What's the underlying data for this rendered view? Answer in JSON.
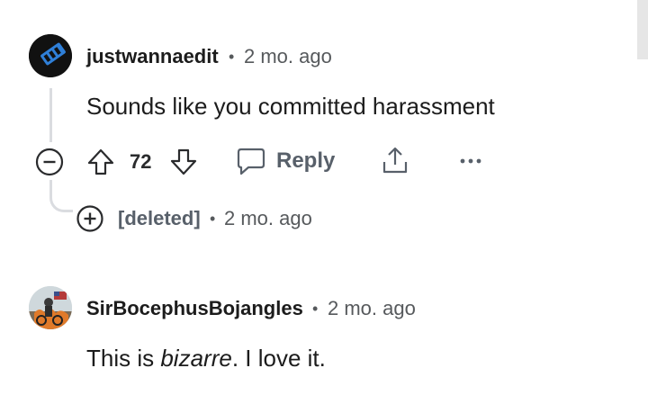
{
  "comments": [
    {
      "username": "justwannaedit",
      "separator": "•",
      "age": "2 mo. ago",
      "text": "Sounds like you committed harassment",
      "actions": {
        "upvotes": "72",
        "reply_label": "Reply"
      },
      "collapsed_child": {
        "username": "[deleted]",
        "separator": "•",
        "age": "2 mo. ago"
      }
    },
    {
      "username": "SirBocephusBojangles",
      "separator": "•",
      "age": "2 mo. ago",
      "text_before": "This is ",
      "text_italic": "bizarre",
      "text_after": ". I love it."
    }
  ],
  "icons": {
    "collapse": "minus-circle-icon",
    "upvote": "arrow-up-icon",
    "downvote": "arrow-down-icon",
    "reply": "speech-bubble-icon",
    "share": "share-icon",
    "more": "ellipsis-icon",
    "expand": "plus-circle-icon"
  },
  "colors": {
    "text": "#1c1c1c",
    "meta": "#56595c",
    "thread_line": "#dadce0",
    "avatar1_bg": "#111111",
    "avatar1_accent": "#2f7fd8"
  }
}
